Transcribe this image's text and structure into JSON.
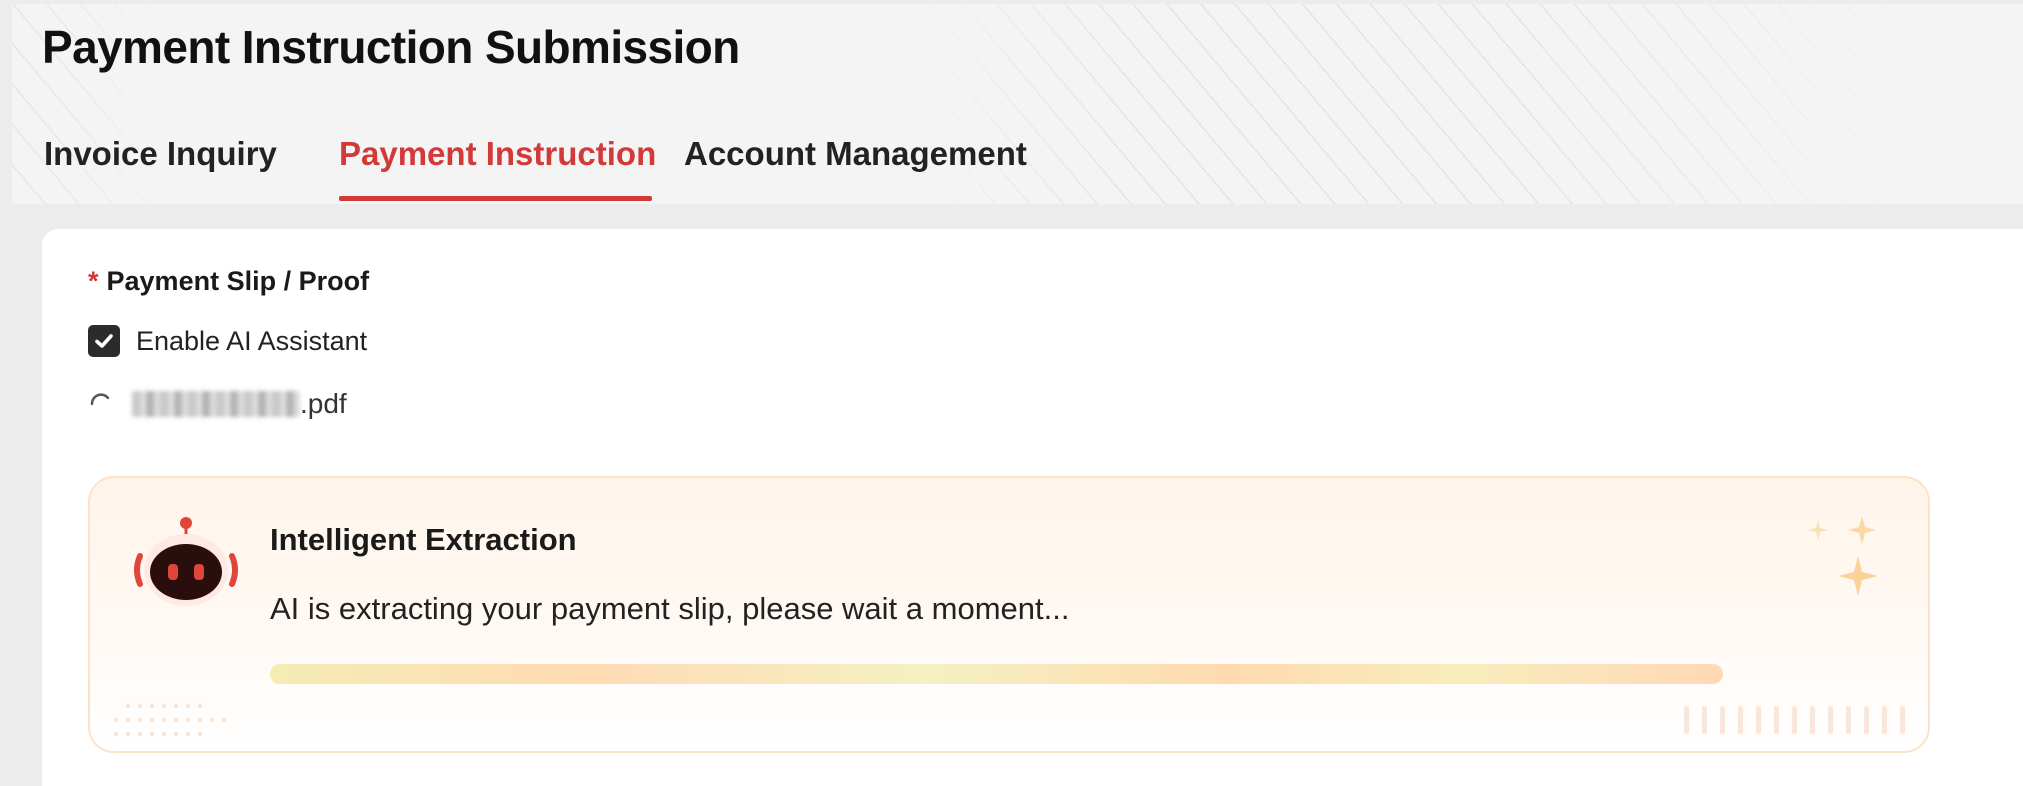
{
  "page": {
    "title": "Payment Instruction Submission"
  },
  "tabs": [
    {
      "label": "Invoice Inquiry",
      "active": false
    },
    {
      "label": "Payment Instruction",
      "active": true
    },
    {
      "label": "Account Management",
      "active": false
    }
  ],
  "form": {
    "field_label": "Payment Slip / Proof",
    "required_marker": "*",
    "ai_toggle": {
      "label": "Enable AI Assistant",
      "checked": true
    },
    "file": {
      "extension": ".pdf",
      "status": "uploading"
    }
  },
  "extraction": {
    "title": "Intelligent Extraction",
    "message": "AI is extracting your payment slip, please wait a moment..."
  },
  "colors": {
    "accent": "#d23a3a",
    "card_border": "#fde2c8",
    "card_bg": "#fff4ea",
    "checkbox": "#2b2b2b"
  },
  "icons": [
    "check-icon",
    "spinner-icon",
    "robot-icon",
    "sparkle-icon"
  ]
}
